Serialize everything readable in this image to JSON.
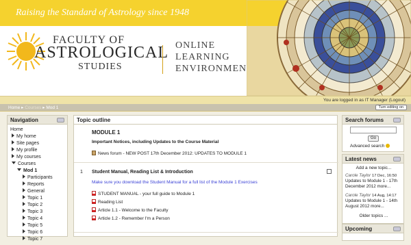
{
  "header": {
    "tagline": "Raising the Standard of Astrology since 1948",
    "logo_line1": "FACULTY OF",
    "logo_line2": "ASTROLOGICAL",
    "logo_line3": "STUDIES",
    "ole_line1": "ONLINE",
    "ole_line2": "LEARNING",
    "ole_line3": "ENVIRONMENT",
    "accent": "#f5d22e"
  },
  "navbar": {
    "login_prefix": "You are logged in as ",
    "user": "IT Manager",
    "logout": "(Logout)",
    "breadcrumb": [
      "Home",
      "Courses",
      "Mod 1"
    ],
    "edit_button": "Turn editing on"
  },
  "navigation": {
    "title": "Navigation",
    "home": "Home",
    "items": [
      "My home",
      "Site pages",
      "My profile",
      "My courses",
      "Courses"
    ],
    "course": "Mod 1",
    "course_items": [
      "Participants",
      "Reports",
      "General",
      "Topic 1",
      "Topic 2",
      "Topic 3",
      "Topic 4",
      "Topic 5",
      "Topic 6",
      "Topic 7"
    ]
  },
  "topic_outline": {
    "title": "Topic outline",
    "module_title": "MODULE 1",
    "module_subtitle": "Important Notices, including Updates to the Course Material",
    "news_forum": "News forum - NEW POST 17th December 2012: UPDATES TO MODULE 1",
    "section_number": "1",
    "section_title": "Student Manual, Reading List & Introduction",
    "section_note": "Make sure you download the Student Manual for a full list of the Module 1 Exercises",
    "resources": [
      "STUDENT MANUAL - your full guide to Module 1",
      "Reading List",
      "Article 1.1 - Welcome to the Faculty",
      "Article 1.2 - Remember I'm a Person"
    ]
  },
  "search_forums": {
    "title": "Search forums",
    "go": "Go",
    "advanced": "Advanced search"
  },
  "latest_news": {
    "title": "Latest news",
    "add": "Add a new topic...",
    "items": [
      {
        "author": "Carole Taylor",
        "date": "17 Dec, 16:50",
        "text": "Updates to Module 1 - 17th December 2012 more..."
      },
      {
        "author": "Carole Taylor",
        "date": "14 Aug, 14:17",
        "text": "Updates to Module 1 - 14th August 2012 more..."
      }
    ],
    "older": "Older topics ..."
  },
  "upcoming": {
    "title": "Upcoming"
  }
}
